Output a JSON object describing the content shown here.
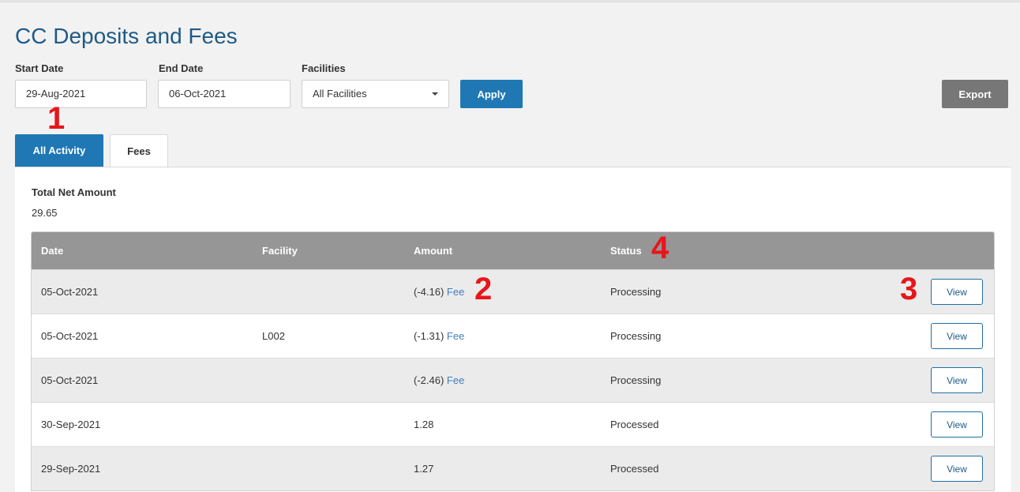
{
  "page": {
    "title": "CC Deposits and Fees"
  },
  "filters": {
    "start_date_label": "Start Date",
    "start_date_value": "29-Aug-2021",
    "end_date_label": "End Date",
    "end_date_value": "06-Oct-2021",
    "facilities_label": "Facilities",
    "facilities_selected": "All Facilities",
    "apply_label": "Apply",
    "export_label": "Export"
  },
  "tabs": [
    {
      "label": "All Activity",
      "active": true
    },
    {
      "label": "Fees",
      "active": false
    }
  ],
  "summary": {
    "total_label": "Total Net Amount",
    "total_value": "29.65"
  },
  "table": {
    "columns": [
      "Date",
      "Facility",
      "Amount",
      "Status"
    ],
    "rows": [
      {
        "date": "05-Oct-2021",
        "facility": "",
        "amount": "(-4.16)",
        "fee": "Fee",
        "status": "Processing",
        "action": "View"
      },
      {
        "date": "05-Oct-2021",
        "facility": "L002",
        "amount": "(-1.31)",
        "fee": "Fee",
        "status": "Processing",
        "action": "View"
      },
      {
        "date": "05-Oct-2021",
        "facility": "",
        "amount": "(-2.46)",
        "fee": "Fee",
        "status": "Processing",
        "action": "View"
      },
      {
        "date": "30-Sep-2021",
        "facility": "",
        "amount": "1.28",
        "fee": "",
        "status": "Processed",
        "action": "View"
      },
      {
        "date": "29-Sep-2021",
        "facility": "",
        "amount": "1.27",
        "fee": "",
        "status": "Processed",
        "action": "View"
      }
    ]
  },
  "annotations": [
    "1",
    "2",
    "3",
    "4"
  ],
  "colors": {
    "primary": "#1f78b4",
    "title": "#1f5a86",
    "marker": "#e8151b",
    "header_bg": "#969696",
    "export_bg": "#777777"
  }
}
